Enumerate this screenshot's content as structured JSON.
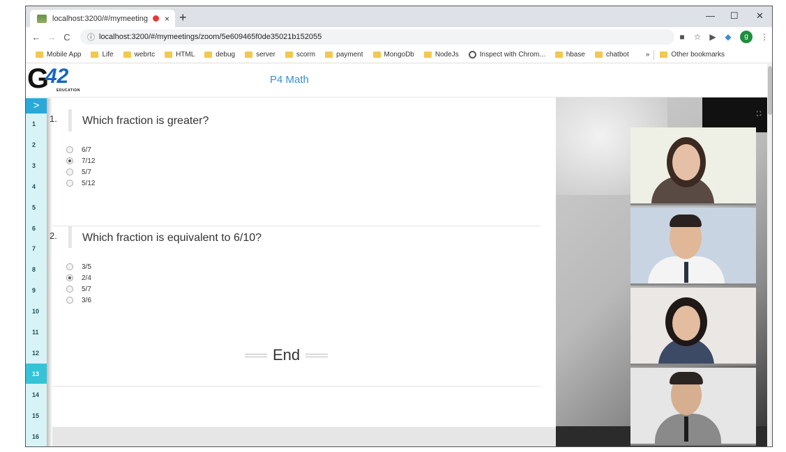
{
  "browser": {
    "tab_title": "localhost:3200/#/mymeeting",
    "tab_close": "×",
    "new_tab": "+",
    "window_minimize": "—",
    "window_maximize": "☐",
    "window_close": "✕",
    "url": "localhost:3200/#/mymeetings/zoom/5e609465f0de35021b152055",
    "profile_initial": "g",
    "bookmarks": [
      {
        "label": "Mobile App",
        "icon": "folder-icon"
      },
      {
        "label": "Life",
        "icon": "folder-icon"
      },
      {
        "label": "webrtc",
        "icon": "folder-icon"
      },
      {
        "label": "HTML",
        "icon": "folder-icon"
      },
      {
        "label": "debug",
        "icon": "folder-icon"
      },
      {
        "label": "server",
        "icon": "folder-icon"
      },
      {
        "label": "scorm",
        "icon": "folder-icon"
      },
      {
        "label": "payment",
        "icon": "folder-icon"
      },
      {
        "label": "MongoDb",
        "icon": "folder-icon"
      },
      {
        "label": "NodeJs",
        "icon": "folder-icon"
      },
      {
        "label": "Inspect with Chrom...",
        "icon": "globe-icon"
      },
      {
        "label": "hbase",
        "icon": "folder-icon"
      },
      {
        "label": "chatbot",
        "icon": "folder-icon"
      }
    ],
    "bookmarks_more": "»",
    "other_bookmarks": "Other bookmarks"
  },
  "app": {
    "logo_g": "G",
    "logo_number": "42",
    "logo_subtitle": "EDUCATION",
    "title": "P4 Math"
  },
  "sidebar": {
    "toggle": ">",
    "numbers": [
      "1",
      "2",
      "3",
      "4",
      "5",
      "6",
      "7",
      "8",
      "9",
      "10",
      "11",
      "12",
      "13",
      "14",
      "15",
      "16"
    ],
    "active": "13"
  },
  "questions": [
    {
      "number": "1.",
      "text": "Which fraction is greater?",
      "options": [
        "6/7",
        "7/12",
        "5/7",
        "5/12"
      ],
      "selected": "7/12"
    },
    {
      "number": "2.",
      "text": "Which fraction is equivalent to 6/10?",
      "options": [
        "3/5",
        "2/4",
        "5/7",
        "3/6"
      ],
      "selected": "2/4"
    }
  ],
  "end_label": "End",
  "colors": {
    "accent": "#29a9d8",
    "active_question": "#35c3d8",
    "sidebar_bg": "#d8f3f6",
    "title": "#3a8fcf"
  }
}
